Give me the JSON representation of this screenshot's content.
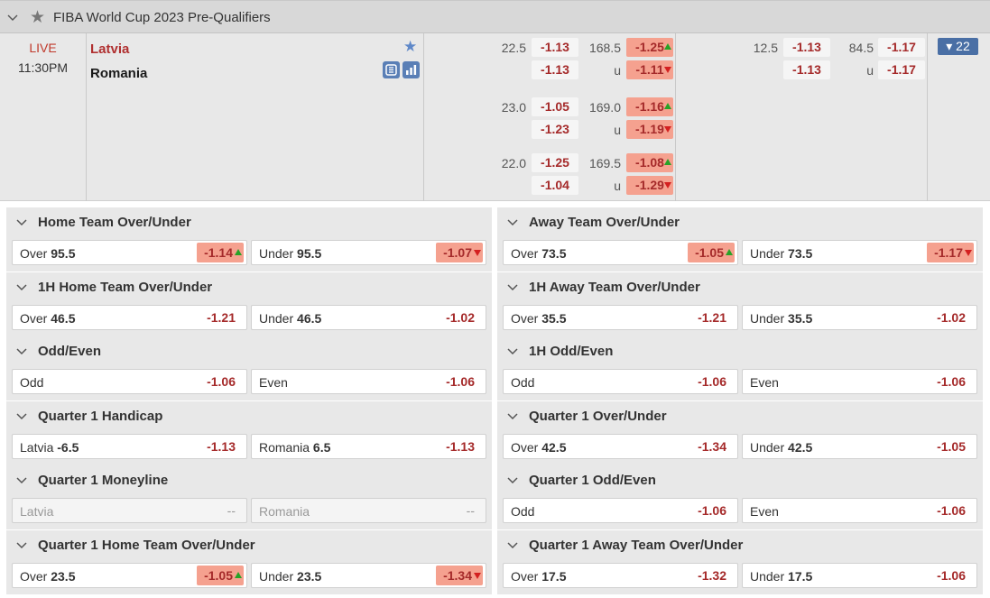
{
  "league": {
    "title": "FIBA World Cup 2023 Pre-Qualifiers"
  },
  "match": {
    "status": "LIVE",
    "time": "11:30PM",
    "home": "Latvia",
    "away": "Romania",
    "more_count": "22",
    "fulltime_lines": [
      {
        "hdp": "22.5",
        "hdp_home": "-1.13",
        "hdp_away": "-1.13",
        "ou": "168.5",
        "ou_label": "u",
        "ou_over": "-1.25",
        "ou_over_trend": "up",
        "ou_under": "-1.11",
        "ou_under_trend": "down"
      },
      {
        "hdp": "23.0",
        "hdp_home": "-1.05",
        "hdp_away": "-1.23",
        "ou": "169.0",
        "ou_label": "u",
        "ou_over": "-1.16",
        "ou_over_trend": "up",
        "ou_under": "-1.19",
        "ou_under_trend": "down"
      },
      {
        "hdp": "22.0",
        "hdp_home": "-1.25",
        "hdp_away": "-1.04",
        "ou": "169.5",
        "ou_label": "u",
        "ou_over": "-1.08",
        "ou_over_trend": "up",
        "ou_under": "-1.29",
        "ou_under_trend": "down"
      }
    ],
    "firsthalf_lines": [
      {
        "hdp": "12.5",
        "hdp_home": "-1.13",
        "hdp_away": "-1.13",
        "ou": "84.5",
        "ou_label": "u",
        "ou_over": "-1.17",
        "ou_under": "-1.17"
      }
    ]
  },
  "markets": [
    {
      "title": "Home Team Over/Under",
      "options": [
        {
          "label": "Over",
          "line": "95.5",
          "odds": "-1.14",
          "trend": "up"
        },
        {
          "label": "Under",
          "line": "95.5",
          "odds": "-1.07",
          "trend": "down"
        }
      ]
    },
    {
      "title": "Away Team Over/Under",
      "options": [
        {
          "label": "Over",
          "line": "73.5",
          "odds": "-1.05",
          "trend": "up"
        },
        {
          "label": "Under",
          "line": "73.5",
          "odds": "-1.17",
          "trend": "down"
        }
      ]
    },
    {
      "title": "1H Home Team Over/Under",
      "options": [
        {
          "label": "Over",
          "line": "46.5",
          "odds": "-1.21"
        },
        {
          "label": "Under",
          "line": "46.5",
          "odds": "-1.02"
        }
      ]
    },
    {
      "title": "1H Away Team Over/Under",
      "options": [
        {
          "label": "Over",
          "line": "35.5",
          "odds": "-1.21"
        },
        {
          "label": "Under",
          "line": "35.5",
          "odds": "-1.02"
        }
      ]
    },
    {
      "title": "Odd/Even",
      "options": [
        {
          "label": "Odd",
          "line": "",
          "odds": "-1.06"
        },
        {
          "label": "Even",
          "line": "",
          "odds": "-1.06"
        }
      ]
    },
    {
      "title": "1H Odd/Even",
      "options": [
        {
          "label": "Odd",
          "line": "",
          "odds": "-1.06"
        },
        {
          "label": "Even",
          "line": "",
          "odds": "-1.06"
        }
      ]
    },
    {
      "title": "Quarter 1 Handicap",
      "options": [
        {
          "label": "Latvia",
          "line": "-6.5",
          "odds": "-1.13"
        },
        {
          "label": "Romania",
          "line": "6.5",
          "odds": "-1.13"
        }
      ]
    },
    {
      "title": "Quarter 1 Over/Under",
      "options": [
        {
          "label": "Over",
          "line": "42.5",
          "odds": "-1.34"
        },
        {
          "label": "Under",
          "line": "42.5",
          "odds": "-1.05"
        }
      ]
    },
    {
      "title": "Quarter 1 Moneyline",
      "options": [
        {
          "label": "Latvia",
          "line": "",
          "odds": "--",
          "disabled": true
        },
        {
          "label": "Romania",
          "line": "",
          "odds": "--",
          "disabled": true
        }
      ]
    },
    {
      "title": "Quarter 1 Odd/Even",
      "options": [
        {
          "label": "Odd",
          "line": "",
          "odds": "-1.06"
        },
        {
          "label": "Even",
          "line": "",
          "odds": "-1.06"
        }
      ]
    },
    {
      "title": "Quarter 1 Home Team Over/Under",
      "options": [
        {
          "label": "Over",
          "line": "23.5",
          "odds": "-1.05",
          "trend": "up"
        },
        {
          "label": "Under",
          "line": "23.5",
          "odds": "-1.34",
          "trend": "down"
        }
      ]
    },
    {
      "title": "Quarter 1 Away Team Over/Under",
      "options": [
        {
          "label": "Over",
          "line": "17.5",
          "odds": "-1.32"
        },
        {
          "label": "Under",
          "line": "17.5",
          "odds": "-1.06"
        }
      ]
    }
  ],
  "colors": {
    "accent": "#4a6fa5",
    "odds_text": "#a52a2a",
    "highlight": "#f5a18f",
    "trend_up": "#27a327",
    "trend_down": "#d42020",
    "live": "#c0392b"
  }
}
